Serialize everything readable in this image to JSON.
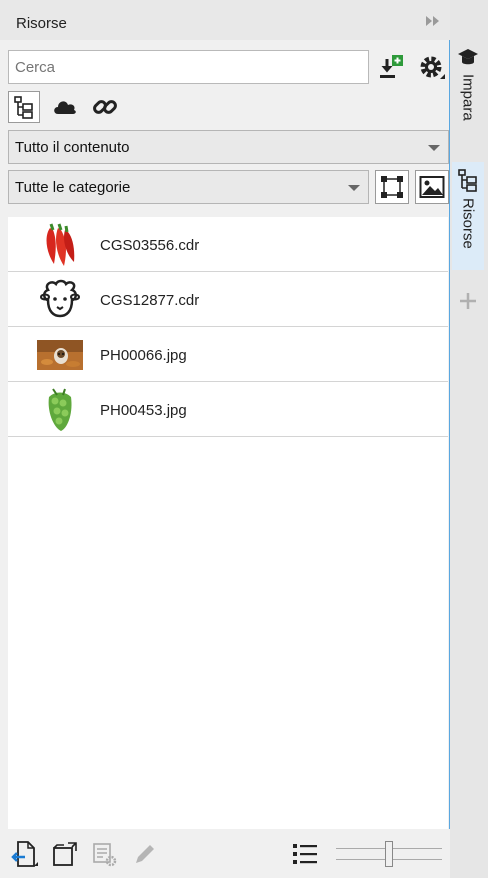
{
  "panel": {
    "title": "Risorse"
  },
  "search": {
    "placeholder": "Cerca"
  },
  "filters": {
    "content_selected": "Tutto il contenuto",
    "category_selected": "Tutte le categorie"
  },
  "files": [
    {
      "name": "CGS03556.cdr",
      "icon": "chili-peppers-thumbnail"
    },
    {
      "name": "CGS12877.cdr",
      "icon": "sheep-face-thumbnail"
    },
    {
      "name": "PH00066.jpg",
      "icon": "dog-photo-thumbnail"
    },
    {
      "name": "PH00453.jpg",
      "icon": "peas-photo-thumbnail"
    }
  ],
  "side_tabs": {
    "learn_label": "Impara",
    "resources_label": "Risorse"
  },
  "colors": {
    "accent_blue": "#1a7bd3",
    "download_green": "#2e9a3a",
    "active_tab": "#dcebf8"
  }
}
